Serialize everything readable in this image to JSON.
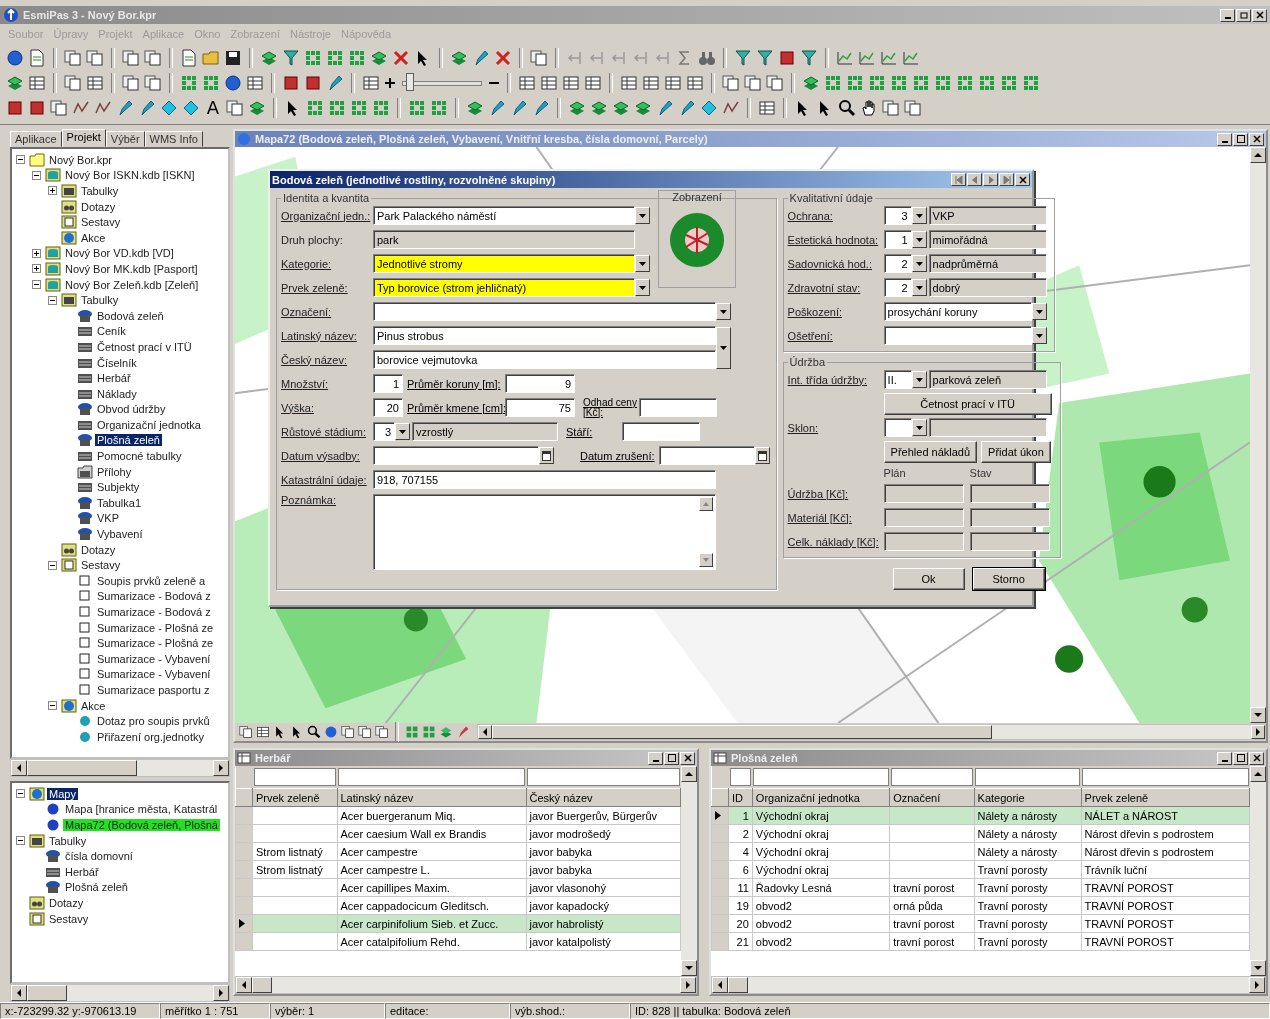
{
  "window": {
    "title": "EsmiPas 3 - Nový Bor.kpr"
  },
  "menu": [
    "Soubor",
    "Úpravy",
    "Projekt",
    "Aplikace",
    "Okno",
    "Zobrazení",
    "Nástroje",
    "Nápověda"
  ],
  "toolbar": {
    "text_tool": "A",
    "zoom_slider": {
      "level": 0.05
    }
  },
  "left_tabs": [
    {
      "label": "Aplikace",
      "selected": false
    },
    {
      "label": "Projekt",
      "selected": true
    },
    {
      "label": "Výběr",
      "selected": false
    },
    {
      "label": "WMS Info",
      "selected": false
    }
  ],
  "project_tree": [
    {
      "label": "Nový Bor.kpr",
      "kind": "folder",
      "expanded": true,
      "selected": false,
      "children": [
        {
          "label": "Nový Bor ISKN.kdb [ISKN]",
          "kind": "database",
          "expanded": true,
          "selected": false,
          "children": [
            {
              "label": "Tabulky",
              "kind": "tables",
              "expanded": false,
              "selected": false
            },
            {
              "label": "Dotazy",
              "kind": "queries",
              "selected": false
            },
            {
              "label": "Sestavy",
              "kind": "reports",
              "selected": false
            },
            {
              "label": "Akce",
              "kind": "actions",
              "selected": false
            }
          ]
        },
        {
          "label": "Nový Bor VD.kdb [VD]",
          "kind": "database",
          "expanded": false,
          "selected": false
        },
        {
          "label": "Nový Bor MK.kdb [Pasport]",
          "kind": "database",
          "expanded": false,
          "selected": false
        },
        {
          "label": "Nový Bor Zeleň.kdb [Zeleň]",
          "kind": "database",
          "expanded": true,
          "selected": false,
          "children": [
            {
              "label": "Tabulky",
              "kind": "tables",
              "expanded": true,
              "selected": false,
              "children": [
                {
                  "label": "Bodová zeleň",
                  "kind": "layer",
                  "selected": false
                },
                {
                  "label": "Ceník",
                  "kind": "table",
                  "selected": false
                },
                {
                  "label": "Četnost prací v ITÜ",
                  "kind": "table",
                  "selected": false
                },
                {
                  "label": "Číselník",
                  "kind": "table",
                  "selected": false
                },
                {
                  "label": "Herbář",
                  "kind": "table",
                  "selected": false
                },
                {
                  "label": "Náklady",
                  "kind": "table",
                  "selected": false
                },
                {
                  "label": "Obvod údržby",
                  "kind": "layer",
                  "selected": false
                },
                {
                  "label": "Organizační jednotka",
                  "kind": "table",
                  "selected": false
                },
                {
                  "label": "Plošná zeleň",
                  "kind": "layer",
                  "selected": true
                },
                {
                  "label": "Pomocné tabulky",
                  "kind": "table",
                  "selected": false
                },
                {
                  "label": "Přílohy",
                  "kind": "attachments",
                  "selected": false
                },
                {
                  "label": "Subjekty",
                  "kind": "table",
                  "selected": false
                },
                {
                  "label": "Tabulka1",
                  "kind": "layer",
                  "selected": false
                },
                {
                  "label": "VKP",
                  "kind": "layer",
                  "selected": false
                },
                {
                  "label": "Vybavení",
                  "kind": "layer",
                  "selected": false
                }
              ]
            },
            {
              "label": "Dotazy",
              "kind": "queries",
              "selected": false
            },
            {
              "label": "Sestavy",
              "kind": "reports",
              "expanded": true,
              "selected": false,
              "children": [
                {
                  "label": "Soupis prvků zeleně a",
                  "kind": "report",
                  "selected": false
                },
                {
                  "label": "Sumarizace - Bodová z",
                  "kind": "report",
                  "selected": false
                },
                {
                  "label": "Sumarizace - Bodová z",
                  "kind": "report",
                  "selected": false
                },
                {
                  "label": "Sumarizace - Plošná ze",
                  "kind": "report",
                  "selected": false
                },
                {
                  "label": "Sumarizace - Plošná ze",
                  "kind": "report",
                  "selected": false
                },
                {
                  "label": "Sumarizace - Vybavení",
                  "kind": "report",
                  "selected": false
                },
                {
                  "label": "Sumarizace - Vybavení",
                  "kind": "report",
                  "selected": false
                },
                {
                  "label": "Sumarizace pasportu z",
                  "kind": "report",
                  "selected": false
                }
              ]
            },
            {
              "label": "Akce",
              "kind": "actions",
              "expanded": true,
              "selected": false,
              "children": [
                {
                  "label": "Dotaz pro soupis prvků",
                  "kind": "action",
                  "selected": false
                },
                {
                  "label": "Přiřazení org.jednotky",
                  "kind": "action",
                  "selected": false
                }
              ]
            }
          ]
        }
      ]
    }
  ],
  "maps_tree": [
    {
      "label": "Mapy",
      "kind": "maps",
      "expanded": true,
      "selected": true,
      "highlighted": false,
      "children": [
        {
          "label": "Mapa [hranice města, Katastrál",
          "kind": "map",
          "selected": false,
          "highlighted": false
        },
        {
          "label": "Mapa72 (Bodová zeleň, Plošná",
          "kind": "map",
          "selected": false,
          "highlighted": true
        }
      ]
    },
    {
      "label": "Tabulky",
      "kind": "tables",
      "expanded": true,
      "selected": false,
      "highlighted": false,
      "children": [
        {
          "label": "čísla domovní",
          "kind": "layer",
          "selected": false,
          "highlighted": false
        },
        {
          "label": "Herbář",
          "kind": "table",
          "selected": false,
          "highlighted": false
        },
        {
          "label": "Plošná zeleň",
          "kind": "layer",
          "selected": false,
          "highlighted": false
        }
      ]
    },
    {
      "label": "Dotazy",
      "kind": "queries",
      "selected": false,
      "highlighted": false
    },
    {
      "label": "Sestavy",
      "kind": "reports",
      "selected": false,
      "highlighted": false
    }
  ],
  "map_window": {
    "title": "Mapa72 (Bodová zeleň, Plošná zeleň, Vybavení, Vnitřní kresba, čísla domovní, Parcely)"
  },
  "dialog": {
    "title": "Bodová zeleň (jednotlivé rostliny, rozvolněné skupiny)",
    "identity": {
      "title": "Identita a kvantita",
      "org_unit": {
        "label": "Organizační jedn.:",
        "value": "Park Palackého náměstí"
      },
      "area_type": {
        "label": "Druh plochy:",
        "value": "park"
      },
      "category": {
        "label": "Kategorie:",
        "value": "Jednotlivé stromy",
        "required": true
      },
      "element": {
        "label": "Prvek zeleně:",
        "value": "Typ borovice  (strom jehličnatý)",
        "required": true
      },
      "marking": {
        "label": "Označení:"
      },
      "latin": {
        "label": "Latinský název:",
        "value": "Pinus strobus"
      },
      "czech": {
        "label": "Český název:",
        "value": "borovice vejmutovka"
      },
      "quantity": {
        "label": "Množství:",
        "value": "1"
      },
      "crown": {
        "label": "Průměr koruny [m]:",
        "value": "9"
      },
      "height": {
        "label": "Výška:",
        "value": "20"
      },
      "trunk": {
        "label": "Průměr kmene [cm]:",
        "value": "75"
      },
      "price": {
        "label": "Odhad ceny [Kč]:"
      },
      "stage": {
        "label": "Růstové stádium:",
        "code": "3",
        "value": "vzrostlý"
      },
      "age": {
        "label": "Stáří:"
      },
      "planted": {
        "label": "Datum výsadby:"
      },
      "removed": {
        "label": "Datum zrušení:"
      },
      "cadastre": {
        "label": "Katastrální údaje:",
        "value": "918, 707155"
      },
      "note": {
        "label": "Poznámka:"
      }
    },
    "display": {
      "title": "Zobrazení"
    },
    "quality": {
      "title": "Kvalitativní údaje",
      "rows": [
        {
          "label": "Ochrana:",
          "code": "3",
          "value": "VKP"
        },
        {
          "label": "Estetická hodnota:",
          "code": "1",
          "value": "mimořádná"
        },
        {
          "label": "Sadovnická hod.:",
          "code": "2",
          "value": "nadprůměrná"
        },
        {
          "label": "Zdravotní stav:",
          "code": "2",
          "value": "dobrý"
        }
      ],
      "damage": {
        "label": "Poškození:",
        "value": "prosychání koruny"
      },
      "care": {
        "label": "Ošetření:"
      }
    },
    "maintenance": {
      "title": "Údržba",
      "class": {
        "label": "Int. třída údržby:",
        "code": "II.",
        "value": "parková zeleň"
      },
      "frequency_button": "Četnost prací v ITÜ",
      "slope": {
        "label": "Sklon:"
      },
      "buttons": [
        "Přehled nákladů",
        "Přidat úkon"
      ],
      "plan": "Plán",
      "state": "Stav",
      "costs": [
        "Údržba [Kč]:",
        "Materiál [Kč]:",
        "Celk. náklady [Kč]:"
      ]
    },
    "buttons": [
      "Ok",
      "Storno"
    ]
  },
  "herbar": {
    "title": "Herbář",
    "columns": [
      "Prvek zeleně",
      "Latinský název",
      "Český název"
    ],
    "rows": [
      {
        "cells": [
          null,
          "Acer buergeranum Miq.",
          "javor Buergerův, Bürgerův"
        ],
        "selected": false
      },
      {
        "cells": [
          null,
          "Acer caesium Wall ex Brandis",
          "javor modrošedý"
        ],
        "selected": false
      },
      {
        "cells": [
          "Strom listnatý",
          "Acer campestre",
          "javor babyka"
        ],
        "selected": false
      },
      {
        "cells": [
          "Strom listnatý",
          "Acer campestre L.",
          "javor babyka"
        ],
        "selected": false
      },
      {
        "cells": [
          null,
          "Acer capillipes Maxim.",
          "javor vlasonohý"
        ],
        "selected": false
      },
      {
        "cells": [
          null,
          "Acer cappadocicum Gleditsch.",
          "javor kapadocký"
        ],
        "selected": false
      },
      {
        "cells": [
          null,
          "Acer carpinifolium Sieb. et Zucc.",
          "javor habrolistý"
        ],
        "selected": true
      },
      {
        "cells": [
          null,
          "Acer catalpifolium Rehd.",
          "javor katalpolistý"
        ],
        "selected": false
      }
    ]
  },
  "plosna": {
    "title": "Plošná zeleň",
    "columns": [
      "ID",
      "Organizační jednotka",
      "Označení",
      "Kategorie",
      "Prvek zeleně"
    ],
    "rows": [
      {
        "cells": [
          "1",
          "Východní okraj",
          null,
          "Nálety a nárosty",
          "NÁLET a NÁROST"
        ],
        "selected": true
      },
      {
        "cells": [
          "2",
          "Východní okraj",
          null,
          "Nálety a nárosty",
          "Nárost dřevin s podrostem"
        ],
        "selected": false
      },
      {
        "cells": [
          "4",
          "Východní okraj",
          null,
          "Nálety a nárosty",
          "Nárost dřevin s podrostem"
        ],
        "selected": false
      },
      {
        "cells": [
          "6",
          "Východní okraj",
          null,
          "Travní porosty",
          "Trávník luční"
        ],
        "selected": false
      },
      {
        "cells": [
          "11",
          "Řadovky Lesná",
          "travní porost",
          "Travní porosty",
          "TRAVNÍ POROST"
        ],
        "selected": false
      },
      {
        "cells": [
          "19",
          "obvod2",
          "orná půda",
          "Travní porosty",
          "TRAVNÍ POROST"
        ],
        "selected": false
      },
      {
        "cells": [
          "20",
          "obvod2",
          "travní porost",
          "Travní porosty",
          "TRAVNÍ POROST"
        ],
        "selected": false
      },
      {
        "cells": [
          "21",
          "obvod2",
          "travní porost",
          "Travní porosty",
          "TRAVNÍ POROST"
        ],
        "selected": false
      }
    ]
  },
  "status_bar": [
    "x:-723299.32  y:-970613.19",
    "měřítko 1 : 751",
    "výběr: 1",
    "editace:",
    "výb.shod.:",
    "ID: 828 || tabulka: Bodová zeleň"
  ]
}
